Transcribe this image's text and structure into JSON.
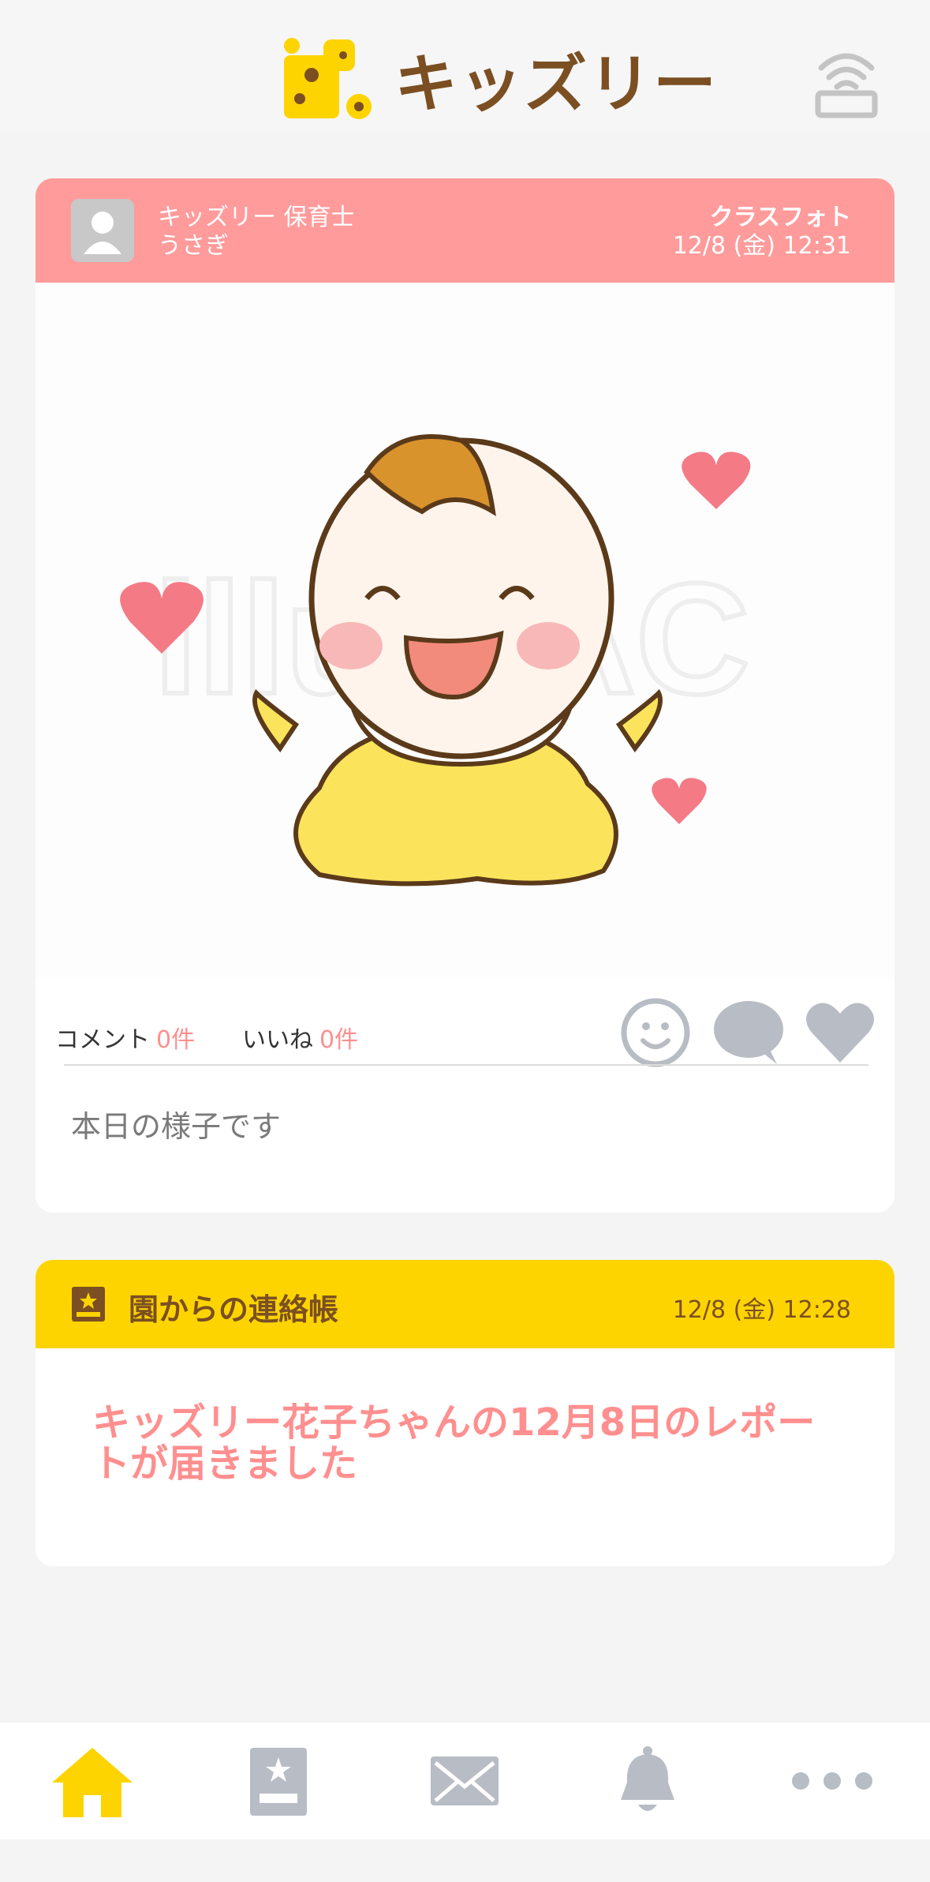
{
  "app": {
    "brand": "キッズリー"
  },
  "post": {
    "author_line1": "キッズリー 保育士",
    "author_line2": "うさぎ",
    "kind": "クラスフォト",
    "datetime": "12/8 (金) 12:31",
    "photo_watermark": "illustAC",
    "comment_label": "コメント",
    "comment_count": "0件",
    "like_label": "いいね",
    "like_count": "0件",
    "body": "本日の様子です"
  },
  "notebook": {
    "title": "園からの連絡帳",
    "datetime": "12/8 (金) 12:28",
    "message": "キッズリー花子ちゃんの12月8日のレポートが届きました"
  },
  "nav": {
    "items": [
      {
        "name": "home",
        "icon": "home-icon",
        "active": true
      },
      {
        "name": "notebook",
        "icon": "notebook-icon",
        "active": false
      },
      {
        "name": "messages",
        "icon": "mail-icon",
        "active": false
      },
      {
        "name": "notifications",
        "icon": "bell-icon",
        "active": false
      },
      {
        "name": "more",
        "icon": "more-icon",
        "active": false
      }
    ]
  },
  "colors": {
    "post_header": "#ff9b9b",
    "notebook_header": "#fdd400",
    "accent_pink": "#ff8f8f",
    "brand_brown": "#7b4f22",
    "nav_active": "#fdd400",
    "nav_inactive": "#b8bcc4"
  }
}
